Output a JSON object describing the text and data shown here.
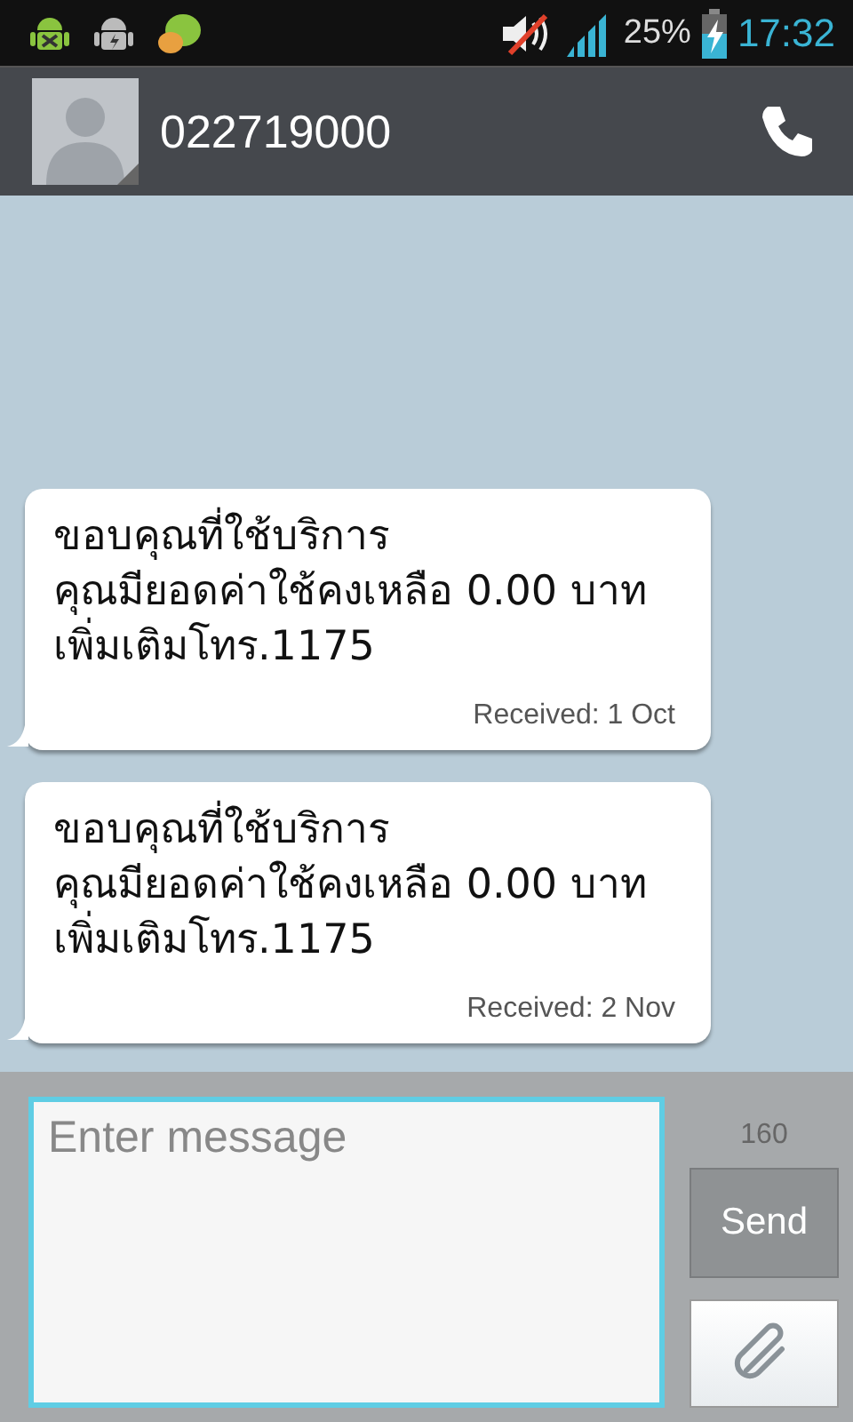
{
  "status_bar": {
    "battery_percent": "25%",
    "time": "17:32"
  },
  "header": {
    "contact": "022719000"
  },
  "messages": [
    {
      "text": "ขอบคุณที่ใช้บริการ คุณมียอดค่าใช้คงเหลือ 0.00 บาท เพิ่มเติมโทร.1175",
      "timestamp": "Received: 1 Oct"
    },
    {
      "text": "ขอบคุณที่ใช้บริการ คุณมียอดค่าใช้คงเหลือ 0.00 บาท เพิ่มเติมโทร.1175",
      "timestamp": "Received: 2 Nov"
    }
  ],
  "composer": {
    "placeholder": "Enter message",
    "char_count": "160",
    "send_label": "Send"
  }
}
